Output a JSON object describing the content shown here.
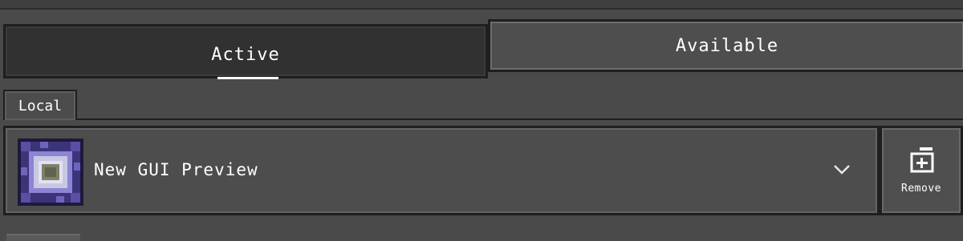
{
  "tabs": {
    "active_label": "Active",
    "available_label": "Available"
  },
  "section": {
    "local_label": "Local"
  },
  "pack": {
    "name": "New GUI Preview",
    "icon": "ender-portal-frame-icon"
  },
  "actions": {
    "expand_icon": "chevron-down-icon",
    "remove_icon": "remove-pack-icon",
    "remove_label": "Remove"
  },
  "colors": {
    "background": "#4a4a4a",
    "active_tab_bg": "#313131",
    "inactive_tab_bg": "#4e4e4e",
    "border": "#1f1f1f",
    "text": "#ffffff"
  }
}
